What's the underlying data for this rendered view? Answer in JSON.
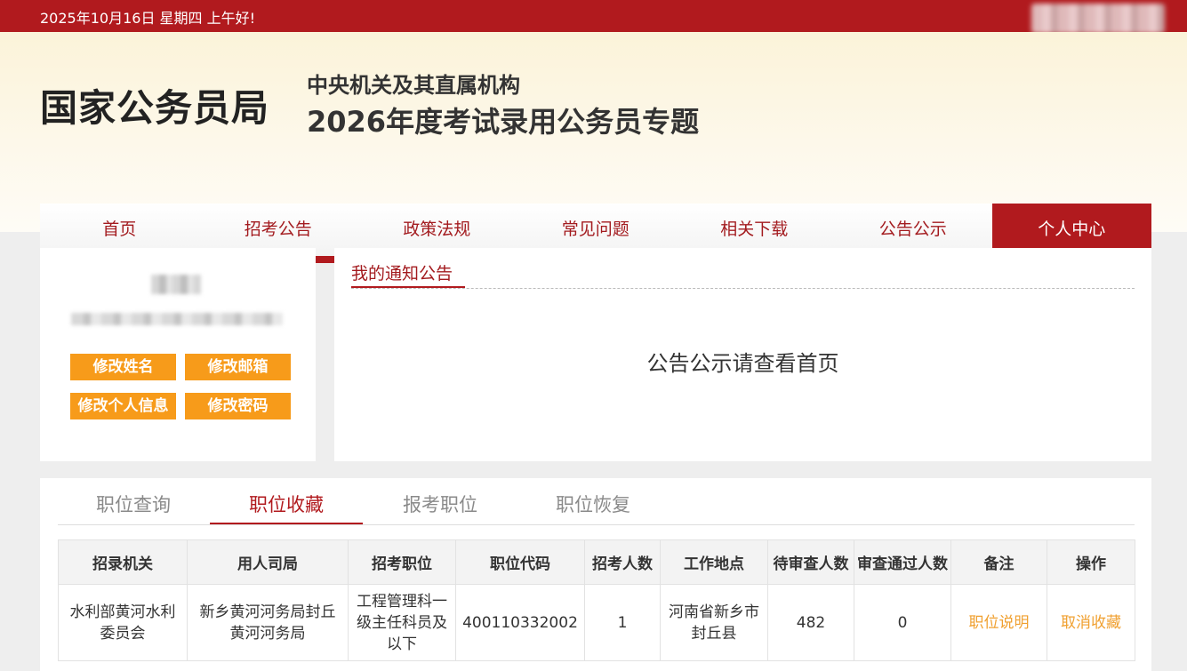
{
  "topbar": {
    "date_text": "2025年10月16日  星期四  上午好!"
  },
  "header": {
    "brand": "国家公务员局",
    "subtitle1": "中央机关及其直属机构",
    "subtitle2": "2026年度考试录用公务员专题"
  },
  "nav": {
    "items": [
      "首页",
      "招考公告",
      "政策法规",
      "常见问题",
      "相关下载",
      "公告公示",
      "个人中心"
    ],
    "active": "个人中心"
  },
  "profile": {
    "buttons": {
      "edit_name": "修改姓名",
      "edit_email": "修改邮箱",
      "edit_info": "修改个人信息",
      "edit_password": "修改密码"
    }
  },
  "notice": {
    "title": "我的通知公告",
    "body": "公告公示请查看首页"
  },
  "jobs": {
    "tabs": [
      "职位查询",
      "职位收藏",
      "报考职位",
      "职位恢复"
    ],
    "active_tab": "职位收藏",
    "columns": [
      "招录机关",
      "用人司局",
      "招考职位",
      "职位代码",
      "招考人数",
      "工作地点",
      "待审查人数",
      "审查通过人数",
      "备注",
      "操作"
    ],
    "rows": [
      {
        "agency": "水利部黄河水利委员会",
        "bureau": "新乡黄河河务局封丘黄河河务局",
        "position": "工程管理科一级主任科员及以下",
        "code": "400110332002",
        "count": "1",
        "location": "河南省新乡市封丘县",
        "pending": "482",
        "approved": "0",
        "remark": "职位说明",
        "action": "取消收藏"
      }
    ]
  },
  "colors": {
    "brand_red": "#b11a1e",
    "button_orange": "#f79b1a",
    "link_orange": "#f0a030"
  }
}
